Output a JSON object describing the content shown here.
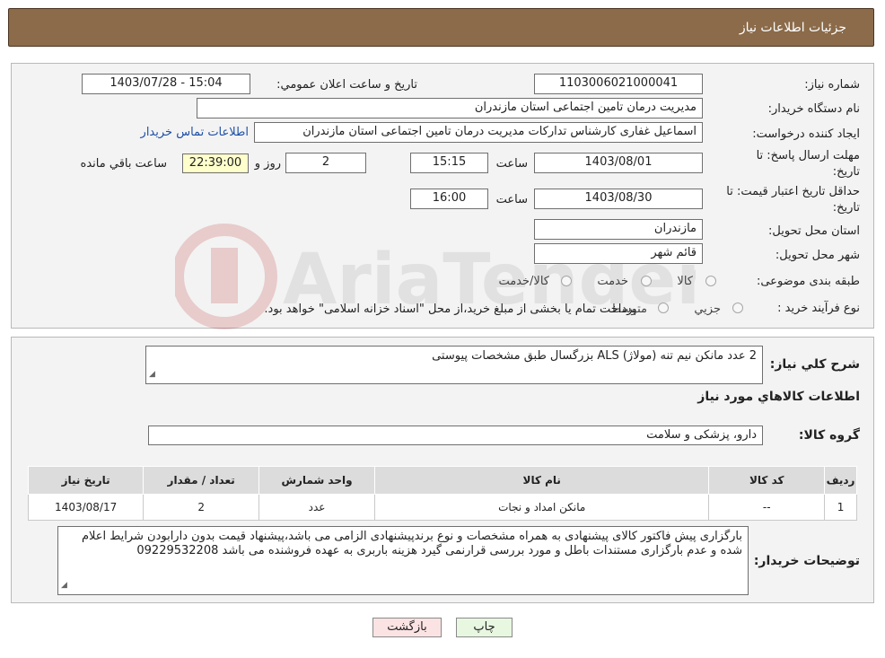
{
  "header": {
    "title": "جزئیات اطلاعات نیاز"
  },
  "fields": {
    "need_number_label": "شماره نیاز:",
    "need_number": "1103006021000041",
    "announce_label": "تاریخ و ساعت اعلان عمومي:",
    "announce_value": "1403/07/28 - 15:04",
    "buyer_org_label": "نام دستگاه خريدار:",
    "buyer_org": "مدیریت درمان تامین اجتماعی استان مازندران",
    "creator_label": "ايجاد کننده درخواست:",
    "creator": "اسماعیل غفاری کارشناس تدارکات مدیریت درمان تامین اجتماعی استان مازندران",
    "contact_link": "اطلاعات تماس خريدار",
    "reply_deadline_label_1": "مهلت ارسال پاسخ: تا",
    "reply_deadline_label_2": "تاريخ:",
    "reply_date": "1403/08/01",
    "time_label": "ساعت",
    "reply_time": "15:15",
    "days": "2",
    "days_label": "روز و",
    "remaining": "22:39:00",
    "remaining_label": "ساعت باقي مانده",
    "validity_label_1": "حداقل تاريخ اعتبار قيمت: تا",
    "validity_label_2": "تاريخ:",
    "validity_date": "1403/08/30",
    "validity_time": "16:00",
    "province_label": "استان محل تحويل:",
    "province": "مازندران",
    "city_label": "شهر محل تحويل:",
    "city": "قائم شهر",
    "category_label": "طبقه بندی موضوعی:",
    "category_options": [
      "کالا",
      "خدمت",
      "کالا/خدمت"
    ],
    "process_label": "نوع فرآيند خريد :",
    "process_options": [
      "جزيي",
      "متوسط"
    ],
    "payment_note": "پرداخت تمام یا بخشی از مبلغ خرید،از محل \"اسناد خزانه اسلامی\" خواهد بود."
  },
  "details": {
    "summary_label": "شرح کلي نياز:",
    "summary": "2 عدد مانکن نیم تنه (مولاژ) ALS بزرگسال طبق مشخصات پیوستی",
    "goods_title": "اطلاعات کالاهاي مورد نياز",
    "goods_group_label": "گروه کالا:",
    "goods_group": "دارو، پزشکی و سلامت",
    "table": {
      "headers": [
        "رديف",
        "کد کالا",
        "نام کالا",
        "واحد شمارش",
        "تعداد / مقدار",
        "تاريخ نياز"
      ],
      "rows": [
        [
          "1",
          "--",
          "مانکن امداد و نجات",
          "عدد",
          "2",
          "1403/08/17"
        ]
      ]
    },
    "buyer_notes_label": "توضيحات خريدار:",
    "buyer_notes": "بارگزاری پیش فاکتور کالای پیشنهادی به همراه مشخصات و نوع برندپیشنهادی الزامی می باشد،پیشنهاد قیمت بدون دارابودن شرایط اعلام شده و عدم بارگزاری مستندات باطل و مورد بررسی قرارنمی گیرد هزینه باربری به عهده فروشنده می باشد 09229532208"
  },
  "buttons": {
    "print": "چاپ",
    "back": "بازگشت"
  },
  "colors": {
    "header_bg": "#8b6b4a",
    "link": "#1d4fa8",
    "print_bg": "#e8f7e0",
    "back_bg": "#fbe3e3"
  }
}
